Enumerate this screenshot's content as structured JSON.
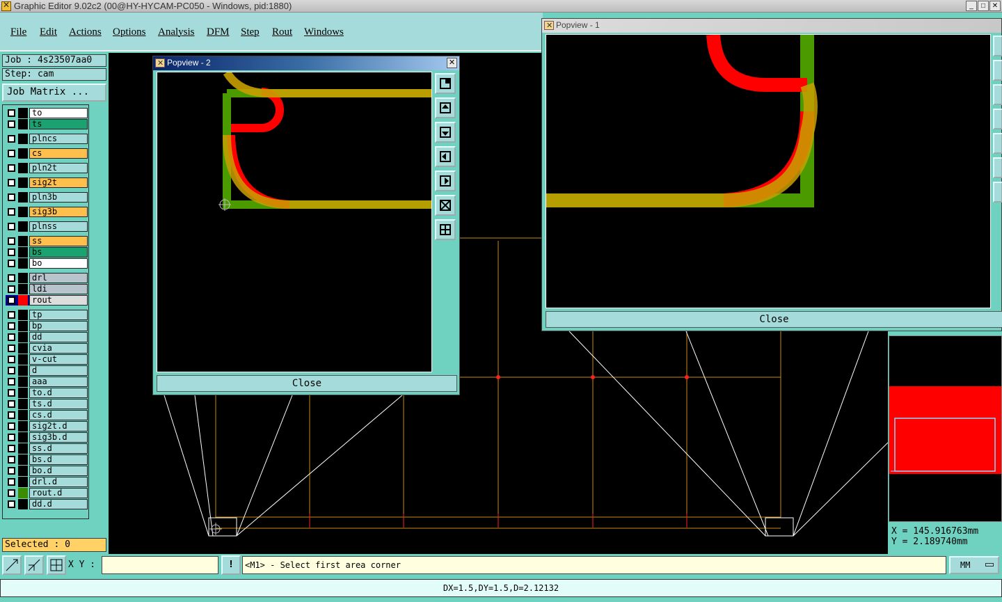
{
  "window": {
    "title": "Graphic Editor 9.02c2 (00@HY-HYCAM-PC050 - Windows, pid:1880)",
    "controls": [
      "_",
      "□",
      "✕"
    ]
  },
  "menu": [
    "File",
    "Edit",
    "Actions",
    "Options",
    "Analysis",
    "DFM",
    "Step",
    "Rout",
    "Windows"
  ],
  "job": {
    "job_label": "Job : 4s23507aa0",
    "step_label": "Step: cam",
    "matrix_button": "Job Matrix ...",
    "selected": "Selected : 0"
  },
  "layers": [
    {
      "name": "to",
      "color": "#ffffff"
    },
    {
      "name": "ts",
      "color": "#1aa370"
    },
    {
      "name": "plncs",
      "color": "#a5dcdb"
    },
    {
      "name": "cs",
      "color": "#ffbf4d"
    },
    {
      "name": "pln2t",
      "color": "#a5dcdb"
    },
    {
      "name": "sig2t",
      "color": "#ffbf4d"
    },
    {
      "name": "pln3b",
      "color": "#a5dcdb"
    },
    {
      "name": "sig3b",
      "color": "#ffbf4d"
    },
    {
      "name": "plnss",
      "color": "#a5dcdb"
    },
    {
      "name": "ss",
      "color": "#ffbf4d"
    },
    {
      "name": "bs",
      "color": "#1aa370"
    },
    {
      "name": "bo",
      "color": "#ffffff"
    },
    {
      "name": "drl",
      "color": "#b8c4cc"
    },
    {
      "name": "ldi",
      "color": "#b8c4cc"
    },
    {
      "name": "rout",
      "color": "#dddddd"
    },
    {
      "name": "tp",
      "color": "#a5dcdb"
    },
    {
      "name": "bp",
      "color": "#a5dcdb"
    },
    {
      "name": "dd",
      "color": "#a5dcdb"
    },
    {
      "name": "cvia",
      "color": "#a5dcdb"
    },
    {
      "name": "v-cut",
      "color": "#a5dcdb"
    },
    {
      "name": "d",
      "color": "#a5dcdb"
    },
    {
      "name": "aaa",
      "color": "#a5dcdb"
    },
    {
      "name": "to.d",
      "color": "#a5dcdb"
    },
    {
      "name": "ts.d",
      "color": "#a5dcdb"
    },
    {
      "name": "cs.d",
      "color": "#a5dcdb"
    },
    {
      "name": "sig2t.d",
      "color": "#a5dcdb"
    },
    {
      "name": "sig3b.d",
      "color": "#a5dcdb"
    },
    {
      "name": "ss.d",
      "color": "#a5dcdb"
    },
    {
      "name": "bs.d",
      "color": "#a5dcdb"
    },
    {
      "name": "bo.d",
      "color": "#a5dcdb"
    },
    {
      "name": "drl.d",
      "color": "#a5dcdb"
    },
    {
      "name": "rout.d",
      "color": "#a5dcdb"
    },
    {
      "name": "dd.d",
      "color": "#a5dcdb"
    }
  ],
  "popview2": {
    "title": "Popview - 2",
    "close_label": "Close"
  },
  "popview1": {
    "title": "Popview - 1",
    "close_label": "Close"
  },
  "coords": {
    "x": "X  =  145.916763mm",
    "y": "Y  =  2.189740mm"
  },
  "command": {
    "xy_label": "X Y :",
    "xy_value": "",
    "info_button": "!",
    "prompt": "<M1> - Select first area corner",
    "units": "MM"
  },
  "status": "DX=1.5,DY=1.5,D=2.12132",
  "colors": {
    "panel": "#6fd2c0",
    "button": "#a5dcdb",
    "active_path": "#ff0000",
    "gold_path": "#c8a000",
    "green_path": "#4a9a00"
  }
}
